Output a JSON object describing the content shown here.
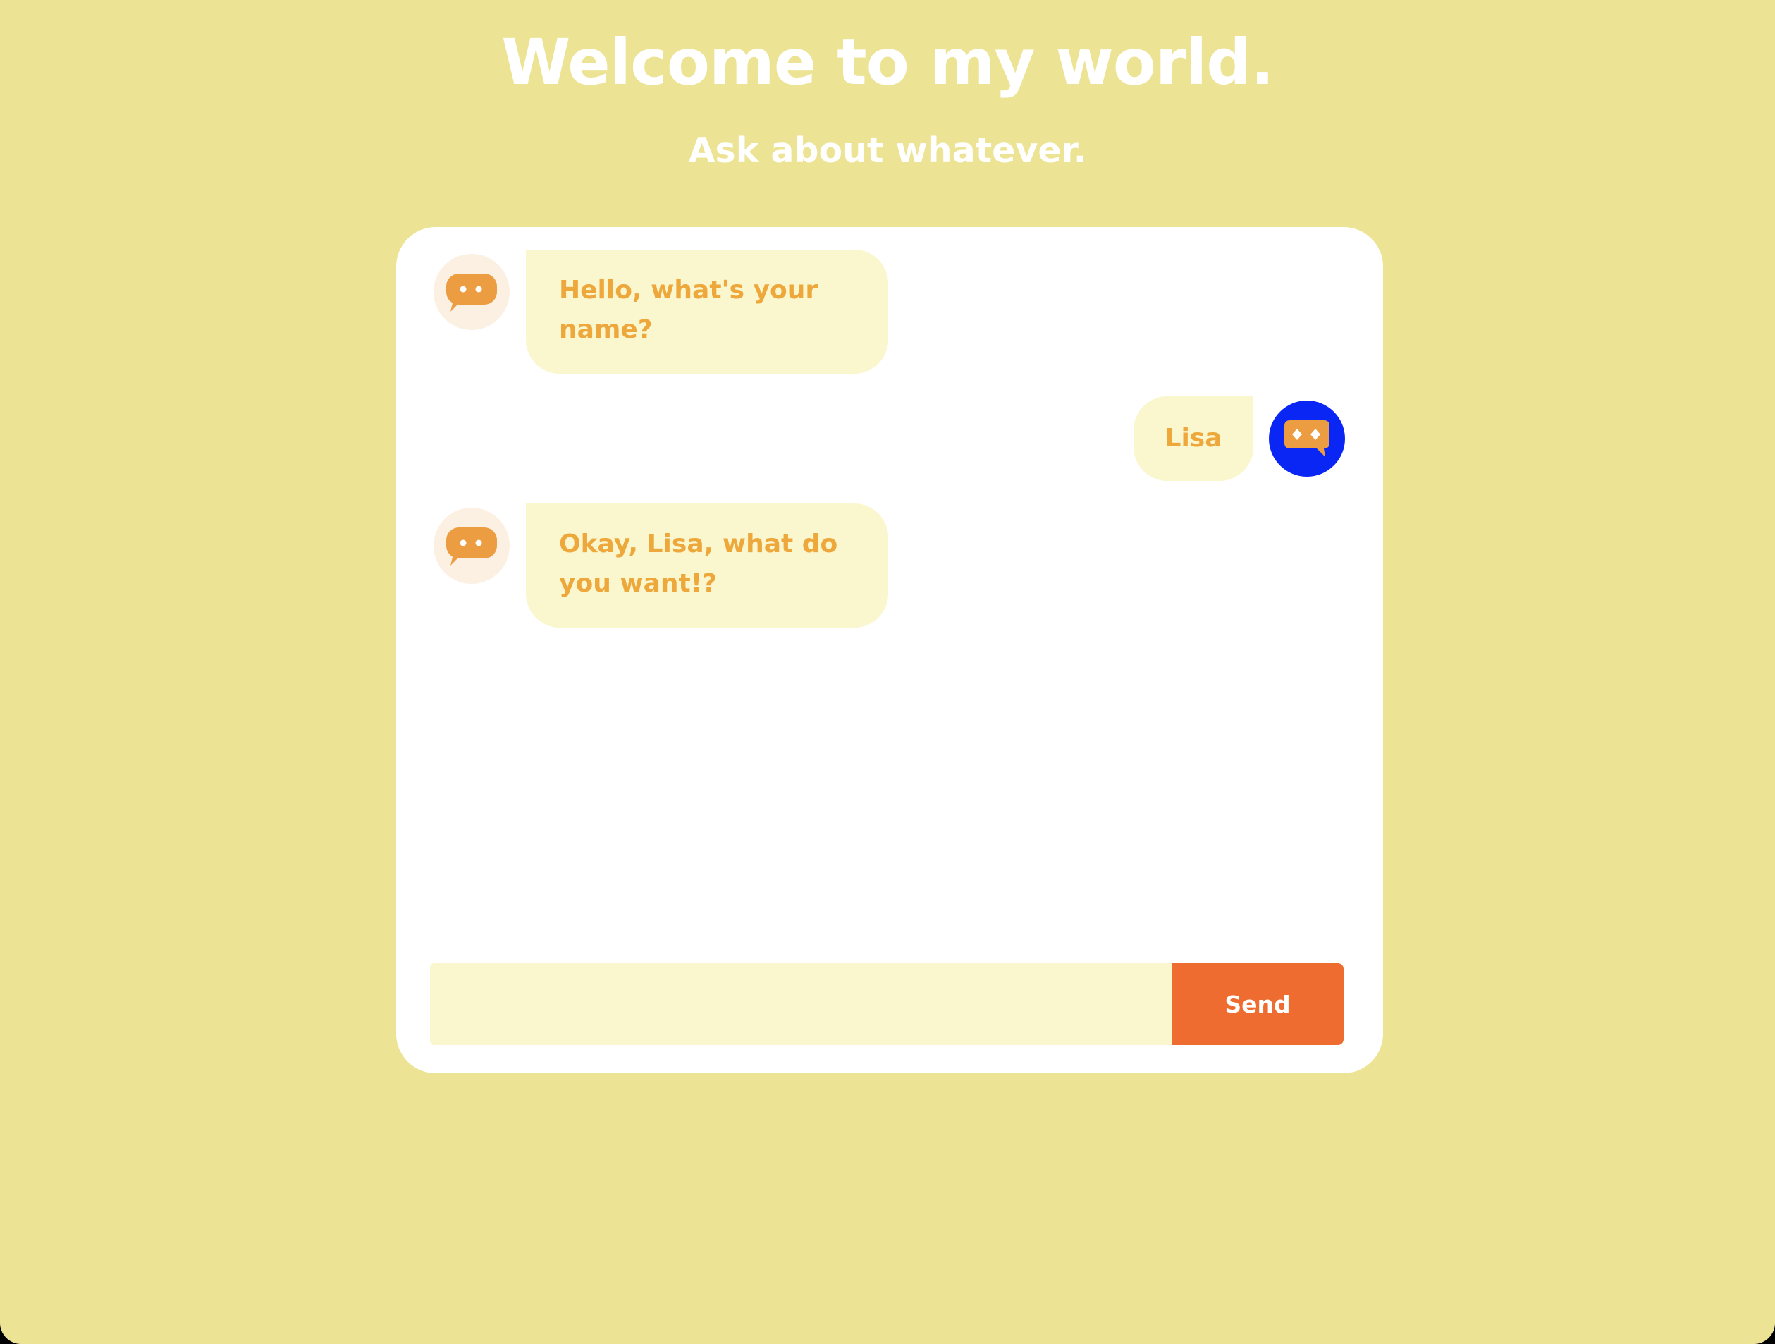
{
  "header": {
    "title": "Welcome to my world.",
    "subtitle": "Ask about whatever."
  },
  "chat": {
    "messages": [
      {
        "sender": "bot",
        "text": "Hello, what's your name?",
        "avatar_icon": "chat-bubble-icon"
      },
      {
        "sender": "user",
        "text": "Lisa",
        "avatar_icon": "mask-icon"
      },
      {
        "sender": "bot",
        "text": "Okay, Lisa, what do you want!?",
        "avatar_icon": "chat-bubble-icon"
      }
    ]
  },
  "composer": {
    "input_value": "",
    "placeholder": "",
    "send_label": "Send"
  },
  "colors": {
    "page_background": "#ece494",
    "card_background": "#ffffff",
    "bubble_background": "#faf6cd",
    "bubble_text": "#eda73b",
    "icon_orange": "#ec9c41",
    "bot_avatar_background": "#fcf0e2",
    "user_avatar_background": "#0a26f4",
    "send_button": "#ee6c30"
  }
}
